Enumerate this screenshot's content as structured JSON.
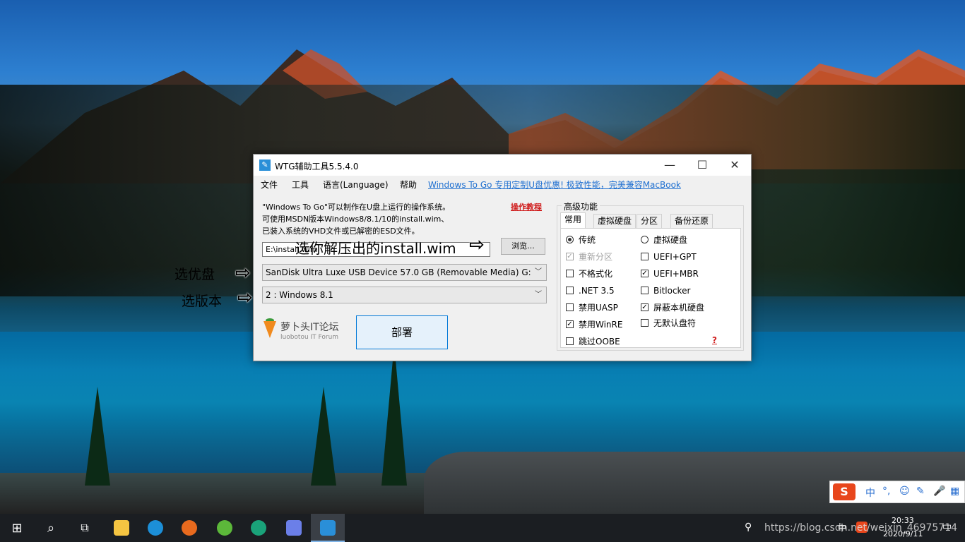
{
  "window": {
    "title": "WTG辅助工具5.5.4.0",
    "minimize": "—",
    "maximize": "☐",
    "close": "✕"
  },
  "menu": {
    "items": [
      "文件",
      "工具",
      "语言(Language)",
      "帮助"
    ],
    "promo_link": "Windows To Go 专用定制U盘优惠! 极致性能，完美兼容MacBook"
  },
  "description": {
    "line1": "\"Windows To Go\"可以制作在U盘上运行的操作系统。",
    "line2": "可使用MSDN版本Windows8/8.1/10的install.wim、",
    "line3": "已装入系统的VHD文件或已解密的ESD文件。",
    "tutorial_link": "操作教程"
  },
  "source": {
    "path_value": "E:\\install.wim",
    "browse_label": "浏览..."
  },
  "drive_select": {
    "selected": "SanDisk Ultra Luxe USB Device 57.0 GB (Removable Media) G:"
  },
  "version_select": {
    "selected": "2 : Windows 8.1"
  },
  "logo": {
    "cn": "萝卜头IT论坛",
    "en": "luobotou IT Forum"
  },
  "deploy_label": "部署",
  "advanced": {
    "group_label": "高级功能",
    "tabs": [
      "常用",
      "虚拟硬盘",
      "分区",
      "备份还原"
    ],
    "active_tab": "常用",
    "left_options": [
      {
        "label": "传统",
        "type": "radio",
        "checked": true,
        "disabled": false
      },
      {
        "label": "重新分区",
        "type": "checkbox",
        "checked": true,
        "disabled": true
      },
      {
        "label": "不格式化",
        "type": "checkbox",
        "checked": false,
        "disabled": false
      },
      {
        "label": ".NET 3.5",
        "type": "checkbox",
        "checked": false,
        "disabled": false
      },
      {
        "label": "禁用UASP",
        "type": "checkbox",
        "checked": false,
        "disabled": false
      },
      {
        "label": "禁用WinRE",
        "type": "checkbox",
        "checked": true,
        "disabled": false
      },
      {
        "label": "跳过OOBE",
        "type": "checkbox",
        "checked": false,
        "disabled": false
      }
    ],
    "right_options": [
      {
        "label": "虚拟硬盘",
        "type": "radio",
        "checked": false,
        "disabled": false
      },
      {
        "label": "UEFI+GPT",
        "type": "checkbox",
        "checked": false,
        "disabled": false
      },
      {
        "label": "UEFI+MBR",
        "type": "checkbox",
        "checked": true,
        "disabled": false
      },
      {
        "label": "Bitlocker",
        "type": "checkbox",
        "checked": false,
        "disabled": false
      },
      {
        "label": "屏蔽本机硬盘",
        "type": "checkbox",
        "checked": true,
        "disabled": false
      },
      {
        "label": "无默认盘符",
        "type": "checkbox",
        "checked": false,
        "disabled": false
      }
    ],
    "help_mark": "?"
  },
  "annotations": {
    "wim": "选你解压出的install.wim",
    "drive": "选优盘",
    "version": "选版本",
    "arrow": "⇨"
  },
  "taskbar": {
    "clock_time": "20:33",
    "clock_date": "2020/9/11",
    "tray_ime": "中",
    "watermark": "https://blog.csdn.net/weixin_46975714"
  },
  "ime_bar": {
    "logo": "S",
    "mode": "中"
  }
}
